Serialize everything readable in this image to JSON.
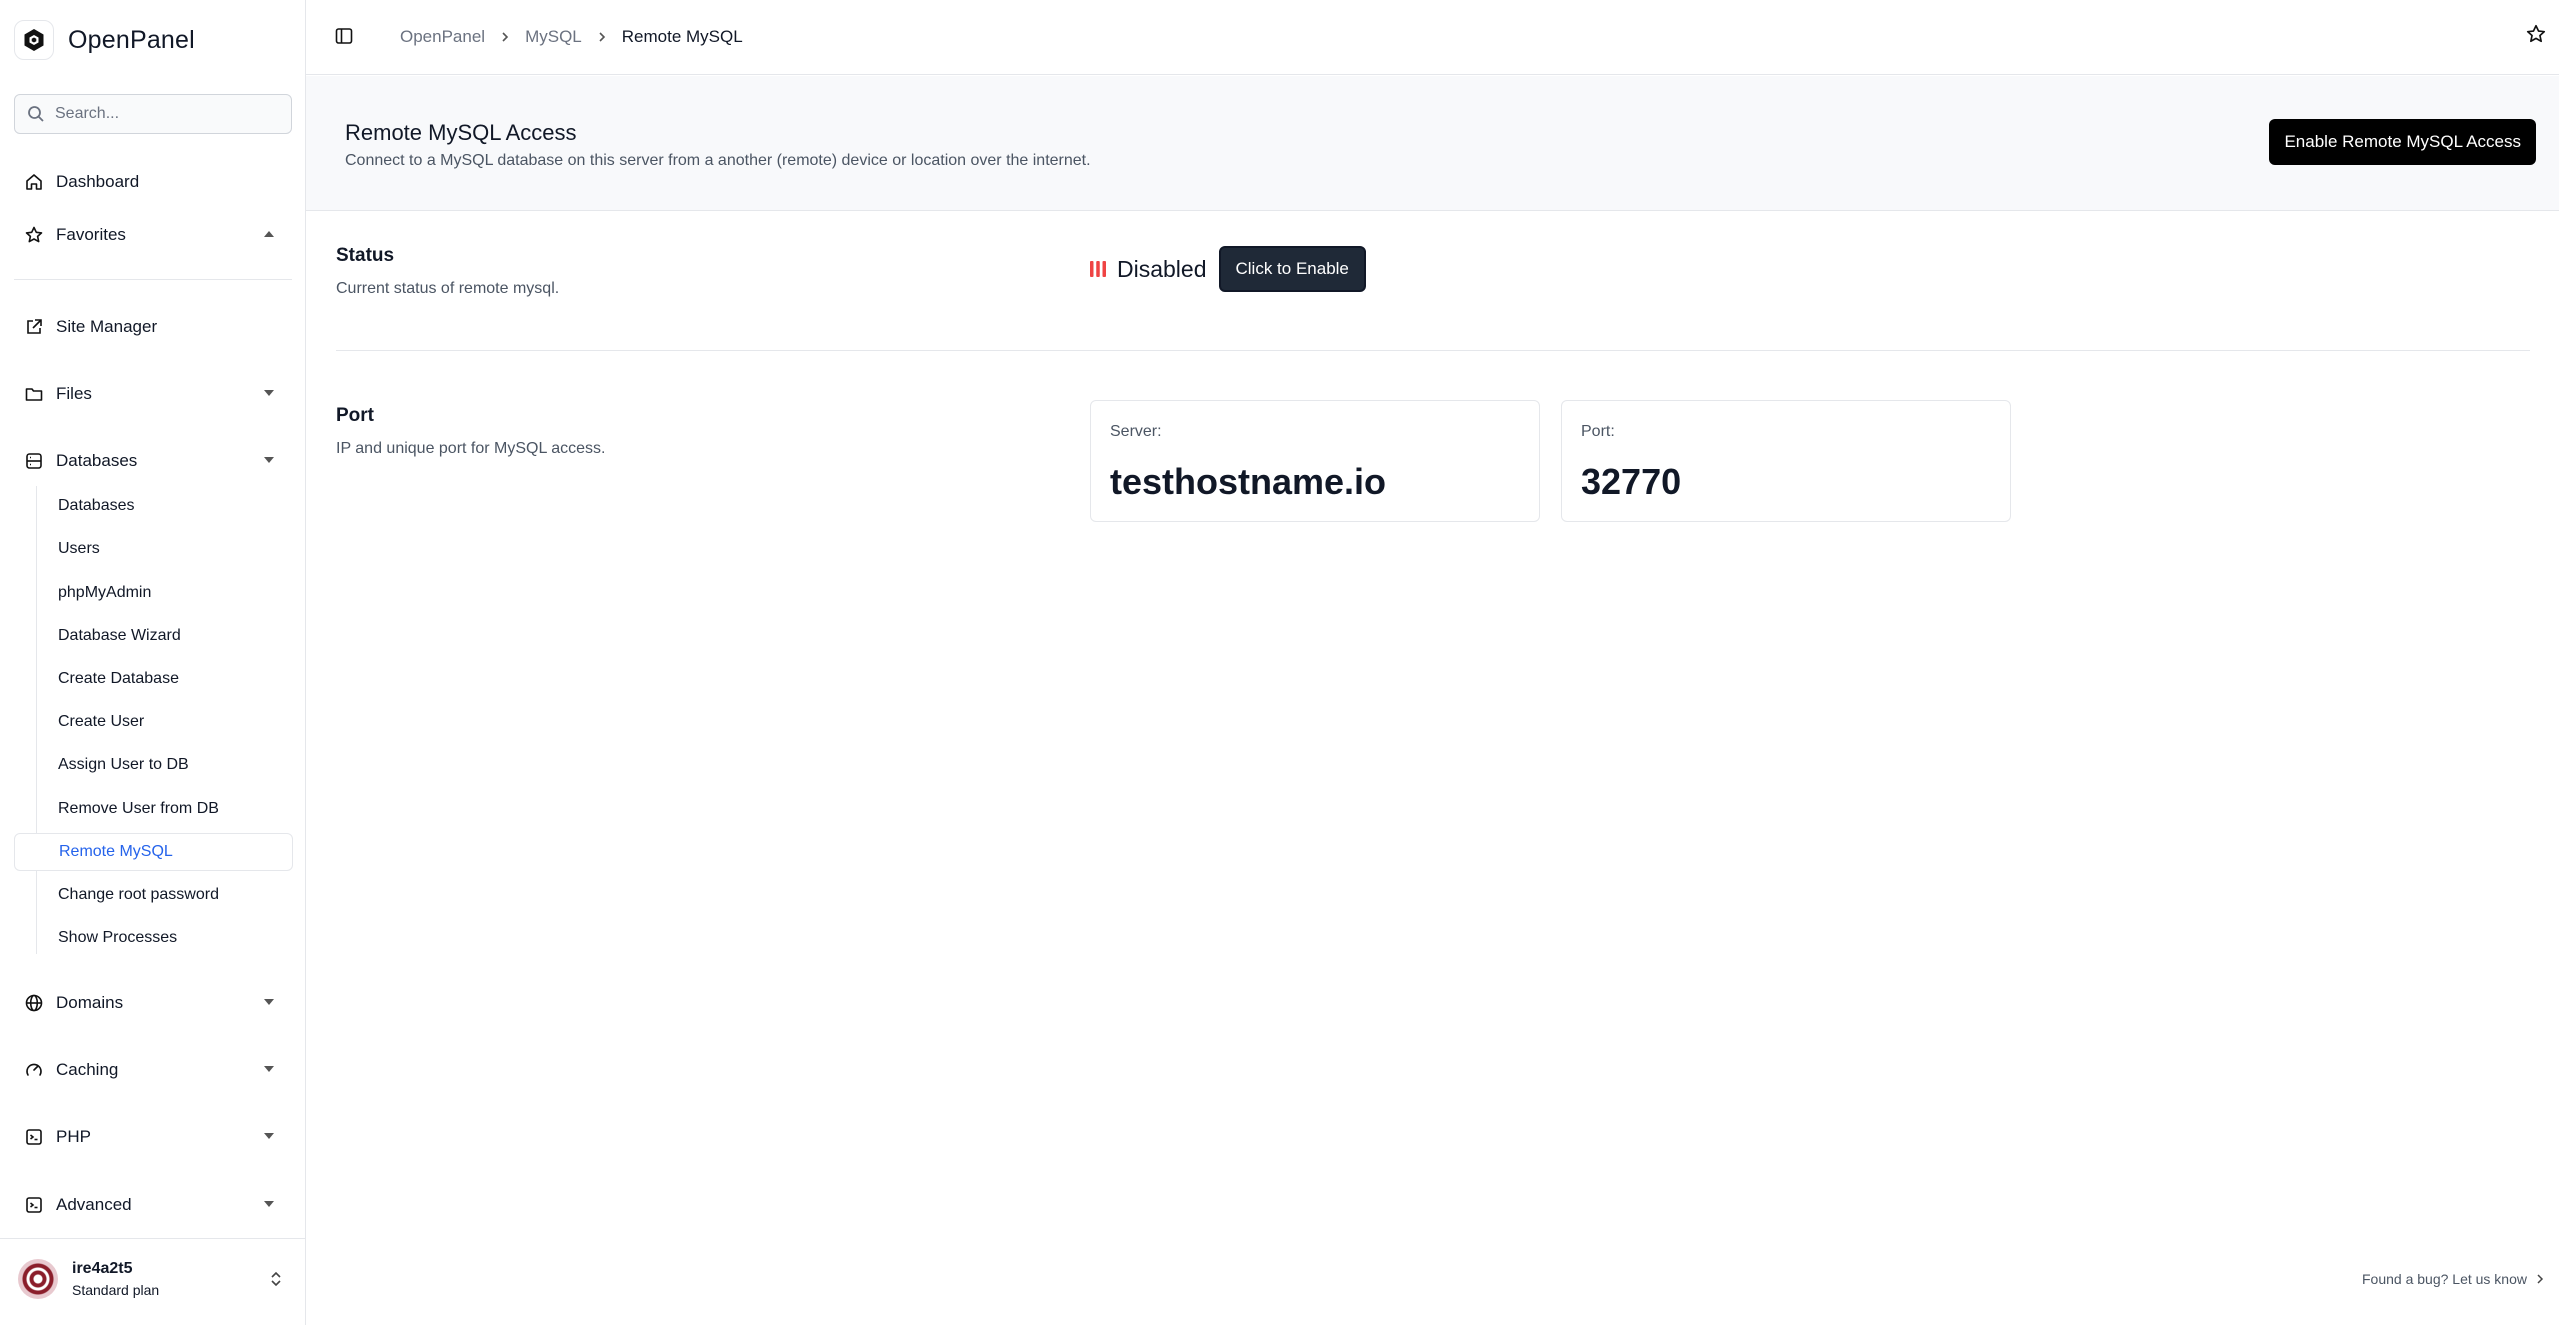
{
  "app": {
    "name": "OpenPanel"
  },
  "search": {
    "placeholder": "Search..."
  },
  "nav": {
    "dashboard": "Dashboard",
    "favorites": "Favorites",
    "site_manager": "Site Manager",
    "files": "Files",
    "databases": "Databases",
    "domains": "Domains",
    "caching": "Caching",
    "php": "PHP",
    "advanced": "Advanced"
  },
  "databases_submenu": [
    {
      "label": "Databases"
    },
    {
      "label": "Users"
    },
    {
      "label": "phpMyAdmin"
    },
    {
      "label": "Database Wizard"
    },
    {
      "label": "Create Database"
    },
    {
      "label": "Create User"
    },
    {
      "label": "Assign User to DB"
    },
    {
      "label": "Remove User from DB"
    },
    {
      "label": "Remote MySQL",
      "active": true
    },
    {
      "label": "Change root password"
    },
    {
      "label": "Show Processes"
    }
  ],
  "user": {
    "name": "ire4a2t5",
    "plan": "Standard plan"
  },
  "breadcrumb": [
    "OpenPanel",
    "MySQL",
    "Remote MySQL"
  ],
  "header": {
    "title": "Remote MySQL Access",
    "description": "Connect to a MySQL database on this server from a another (remote) device or location over the internet.",
    "enable_button": "Enable Remote MySQL Access"
  },
  "status_section": {
    "title": "Status",
    "description": "Current status of remote mysql.",
    "status": "Disabled",
    "status_color": "#ef4444",
    "enable_button": "Click to Enable"
  },
  "port_section": {
    "title": "Port",
    "description": "IP and unique port for MySQL access.",
    "server_label": "Server:",
    "server_value": "testhostname.io",
    "port_label": "Port:",
    "port_value": "32770"
  },
  "footer": {
    "bug_link": "Found a bug? Let us know"
  },
  "colors": {
    "accent": "#2563eb",
    "primary_button": "#000000",
    "disabled": "#ef4444"
  }
}
